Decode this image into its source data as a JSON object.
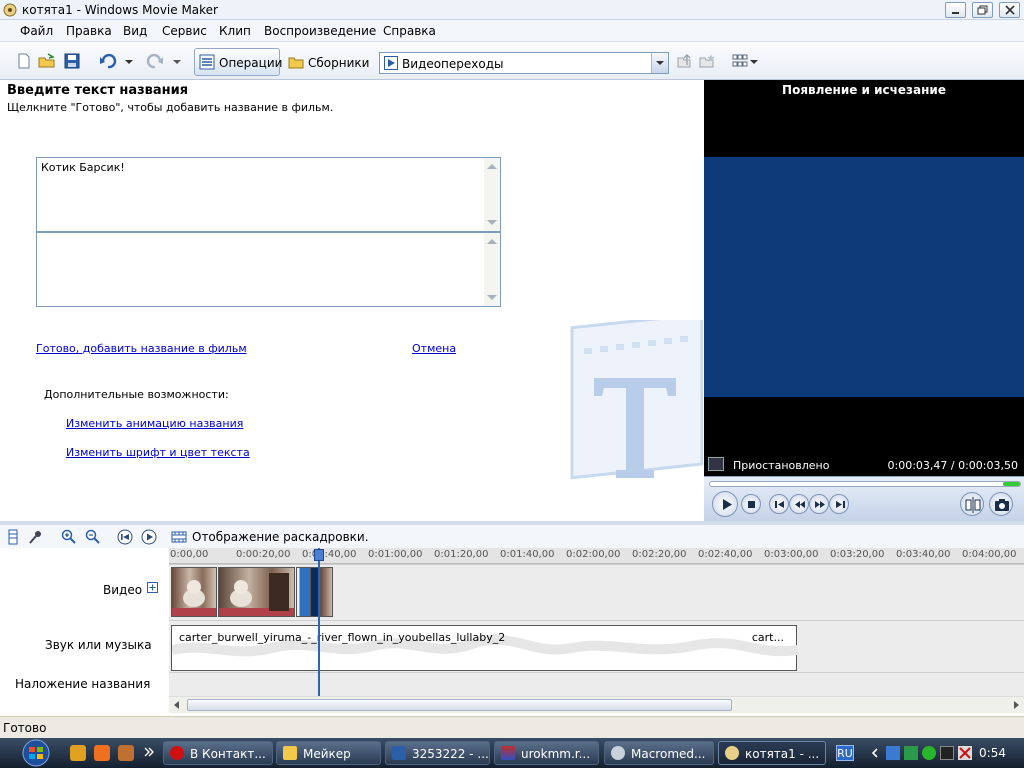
{
  "window": {
    "title": "котята1 - Windows Movie Maker"
  },
  "menu": [
    "Файл",
    "Правка",
    "Вид",
    "Сервис",
    "Клип",
    "Воспроизведение",
    "Справка"
  ],
  "toolbar": {
    "operations": "Операции",
    "collections": "Сборники",
    "combo_value": "Видеопереходы"
  },
  "task": {
    "title": "Введите текст названия",
    "subtitle": "Щелкните \"Готово\", чтобы добавить название в фильм.",
    "text1": "Котик Барсик!",
    "text2": "",
    "done_link": "Готово, добавить название в фильм",
    "cancel_link": "Отмена",
    "extra_label": "Дополнительные возможности:",
    "change_animation": "Изменить анимацию названия",
    "change_font": "Изменить шрифт и цвет текста"
  },
  "preview": {
    "title": "Появление и исчезание",
    "state": "Приостановлено",
    "time": "0:00:03,47 / 0:00:03,50",
    "seek_progress": 0.99
  },
  "timeline": {
    "mode_label": "Отображение раскадровки.",
    "ruler": [
      "0:00,00",
      "0:00:20,00",
      "0:00:40,00",
      "0:01:00,00",
      "0:01:20,00",
      "0:01:40,00",
      "0:02:00,00",
      "0:02:20,00",
      "0:02:40,00",
      "0:03:00,00",
      "0:03:20,00",
      "0:03:40,00",
      "0:04:00,00",
      "0:04"
    ],
    "tracks": {
      "video": "Видео",
      "audio": "Звук или музыка",
      "overlay": "Наложение названия"
    },
    "audio_clip": "carter_burwell_yiruma_-_river_flown_in_youbellas_lullaby_2",
    "audio_clip_tail": "cart..."
  },
  "status": "Готово",
  "taskbar": {
    "tasks": [
      "В Контакт...",
      "Мейкер",
      "3253222 - ...",
      "urokmm.r...",
      "Macromed...",
      "котята1 - ..."
    ],
    "lang": "RU",
    "clock": "0:54"
  },
  "colors": {
    "monitor": "#0d3b7a",
    "link": "#0000cc",
    "playhead": "#2e63b8"
  }
}
